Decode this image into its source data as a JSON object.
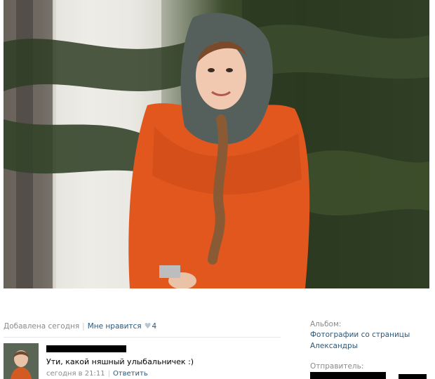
{
  "photo": {
    "alt_icon": "portrait-photo"
  },
  "meta": {
    "added": "Добавлена сегодня",
    "separator": "|",
    "like_label": "Мне нравится",
    "like_count": "4",
    "heart_icon": "heart-icon"
  },
  "comment": {
    "text": "Ути, какой няшный улыбальничек :)",
    "time": "сегодня в 21:11",
    "separator": "|",
    "reply_label": "Ответить"
  },
  "sidebar": {
    "album_label": "Альбом:",
    "album_name_line1": "Фотографии со страницы",
    "album_name_line2": "Александры",
    "sender_label": "Отправитель:"
  },
  "colors": {
    "link": "#2b587a",
    "muted": "#8a8a8a",
    "coat": "#e2571e"
  }
}
